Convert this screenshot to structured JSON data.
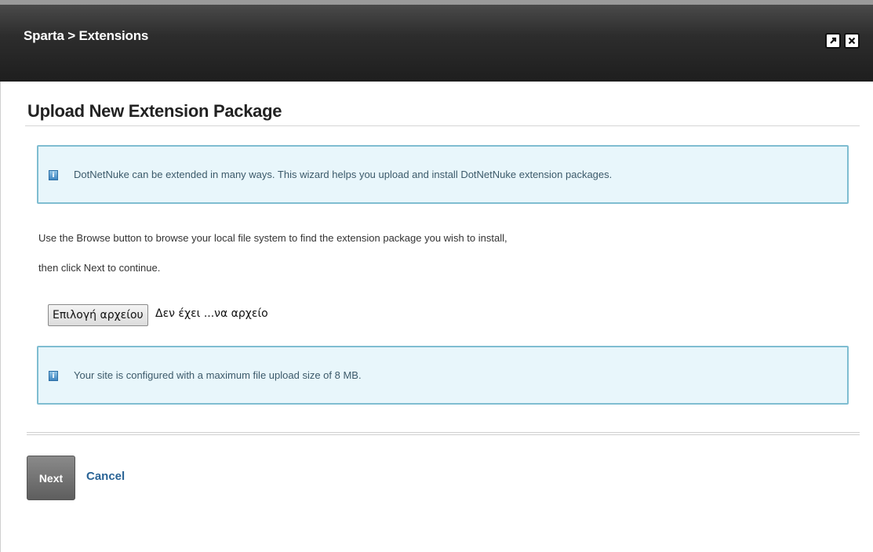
{
  "window": {
    "title": "Sparta > Extensions",
    "maximize_icon": "external-open-icon",
    "close_icon": "close-icon"
  },
  "page": {
    "heading": "Upload New Extension Package"
  },
  "info": {
    "intro": "DotNetNuke can be extended in many ways. This wizard helps you upload and install DotNetNuke extension packages.",
    "size_limit": "Your site is configured with a maximum file upload size of 8 MB.",
    "icon": "info-icon"
  },
  "instructions": {
    "line1": "Use the Browse button to browse your local file system to find the extension package you wish to install,",
    "line2": "then click Next to continue."
  },
  "file_input": {
    "button_label": "Επιλογή αρχείου",
    "status": "Δεν έχει ...να αρχείο"
  },
  "actions": {
    "next_label": "Next",
    "cancel_label": "Cancel"
  },
  "colors": {
    "titlebar": "#2d2d2d",
    "info_bg": "#e8f6fb",
    "info_border": "#7fbdd1",
    "link": "#2a6496"
  }
}
